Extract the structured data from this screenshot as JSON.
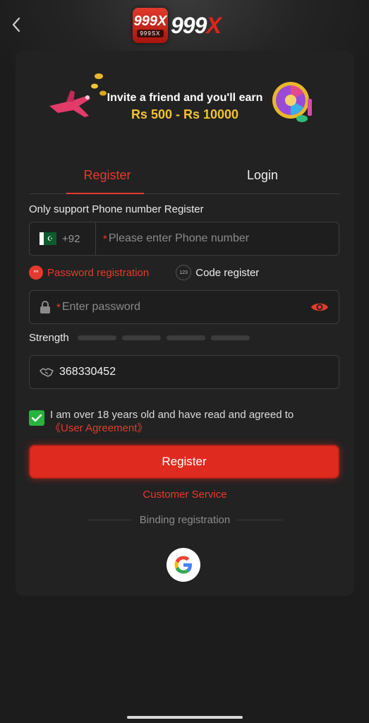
{
  "header": {
    "logo_badge_big": "999X",
    "logo_badge_small": "999SX",
    "logo_word_main": "999",
    "logo_word_x": "X"
  },
  "banner": {
    "line1": "Invite a friend and you'll earn",
    "line2": "Rs 500 - Rs 10000"
  },
  "tabs": [
    {
      "label": "Register",
      "active": true
    },
    {
      "label": "Login",
      "active": false
    }
  ],
  "form": {
    "hint": "Only support Phone number Register",
    "phone": {
      "country_code": "+92",
      "required_mark": "*",
      "placeholder": "Please enter Phone number"
    },
    "register_options": {
      "password_label": "Password registration",
      "password_icon": "**",
      "code_label": "Code register",
      "code_icon": "123"
    },
    "password": {
      "required_mark": "*",
      "placeholder": "Enter password"
    },
    "strength": {
      "label": "Strength",
      "level": 0,
      "segments": 4
    },
    "invite_code": {
      "value": "368330452"
    },
    "agreement": {
      "checked": true,
      "text": "I am over 18 years old and have read and agreed to",
      "link": "《User Agreement》"
    },
    "submit_label": "Register"
  },
  "customer_service": "Customer Service",
  "binding_label": "Binding registration",
  "colors": {
    "accent": "#e53a2e",
    "background": "#1c1c1c",
    "card": "#222222",
    "check": "#27b33d",
    "highlight": "#f3c230"
  },
  "icons": [
    "back-chevron-icon",
    "pakistan-flag-icon",
    "lock-icon",
    "eye-icon",
    "handshake-icon",
    "check-icon",
    "google-icon"
  ]
}
